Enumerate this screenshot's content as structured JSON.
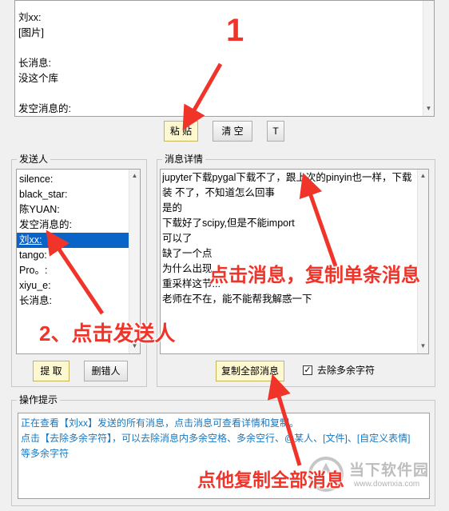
{
  "message_area": {
    "lines": [
      "刘xx:",
      "[图片]",
      "",
      "长消息:",
      "没这个库",
      "",
      "发空消息的:"
    ]
  },
  "top_buttons": {
    "paste": "粘 贴",
    "clear": "清 空",
    "t": "T"
  },
  "sender_panel": {
    "title": "发送人",
    "items": [
      "silence:",
      "black_star:",
      "陈YUAN:",
      "发空消息的:",
      "刘xx:",
      "tango:",
      "Pro。:",
      "xiyu_e:",
      "长消息:"
    ],
    "selected_index": 4,
    "extract_button": "提 取",
    "delete_button": "删错人"
  },
  "detail_panel": {
    "title": "消息详情",
    "lines": [
      "jupyter下载pygal下载不了，跟上次的pinyin也一样，下载",
      "装 不了，不知道怎么回事",
      "是的",
      "下载好了scipy,但是不能import",
      "可以了",
      "缺了一个点",
      "为什么出现...",
      "重采样这节...",
      "老师在不在，能不能帮我解惑一下"
    ],
    "copy_all_button": "复制全部消息",
    "checkbox_label": "去除多余字符",
    "checkbox_checked": true
  },
  "hint_panel": {
    "title": "操作提示",
    "lines": [
      "正在查看【刘xx】发送的所有消息，点击消息可查看详情和复制。",
      "点击【去除多余字符】，可以去除消息内多余空格、多余空行、@某人、[文件]、[自定义表情]",
      "等多余字符"
    ]
  },
  "annotations": {
    "step1": "1",
    "step2": "2、点击发送人",
    "click_message": "点击消息，复制单条消息",
    "copy_all": "点他复制全部消息"
  },
  "watermark": {
    "text": "当下软件园",
    "url": "www.downxia.com"
  },
  "colors": {
    "annotation": "#f0342a",
    "selection": "#0a64c8",
    "hint_text": "#1878c0"
  }
}
